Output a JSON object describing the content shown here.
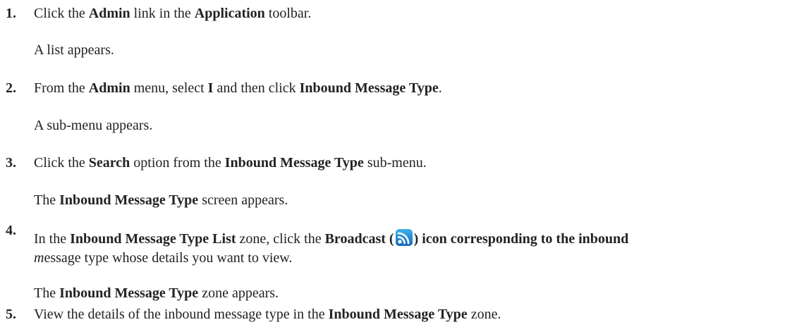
{
  "steps": [
    {
      "number": "1.",
      "parts": [
        "Click the ",
        "Admin",
        " link in the ",
        "Application",
        " toolbar."
      ],
      "result": "A list appears."
    },
    {
      "number": "2.",
      "parts": [
        "From the ",
        "Admin",
        " menu, select ",
        "I",
        " and then click ",
        "Inbound Message Type",
        "."
      ],
      "result": "A sub-menu appears."
    },
    {
      "number": "3.",
      "parts": [
        "Click the ",
        "Search",
        " option from the ",
        "Inbound Message Type",
        " sub-menu."
      ],
      "result_parts": [
        "The ",
        "Inbound Message Type",
        " screen appears."
      ]
    },
    {
      "number": "4.",
      "parts": [
        "In the ",
        "Inbound Message Type List",
        " zone, click the ",
        "Broadcast",
        " (",
        ") icon corresponding to the inbound"
      ],
      "line2_italic": "m",
      "line2_rest": "essage type whose details you want to view.",
      "result_parts": [
        "The ",
        "Inbound Message Type",
        " zone appears."
      ],
      "icon": "broadcast-icon"
    },
    {
      "number": "5.",
      "parts": [
        "View the details of the inbound message type in the ",
        "Inbound Message Type",
        " zone."
      ]
    }
  ],
  "colors": {
    "text": "#222222",
    "icon_blue": "#1e73c8",
    "icon_accent": "#2ea8e0"
  }
}
